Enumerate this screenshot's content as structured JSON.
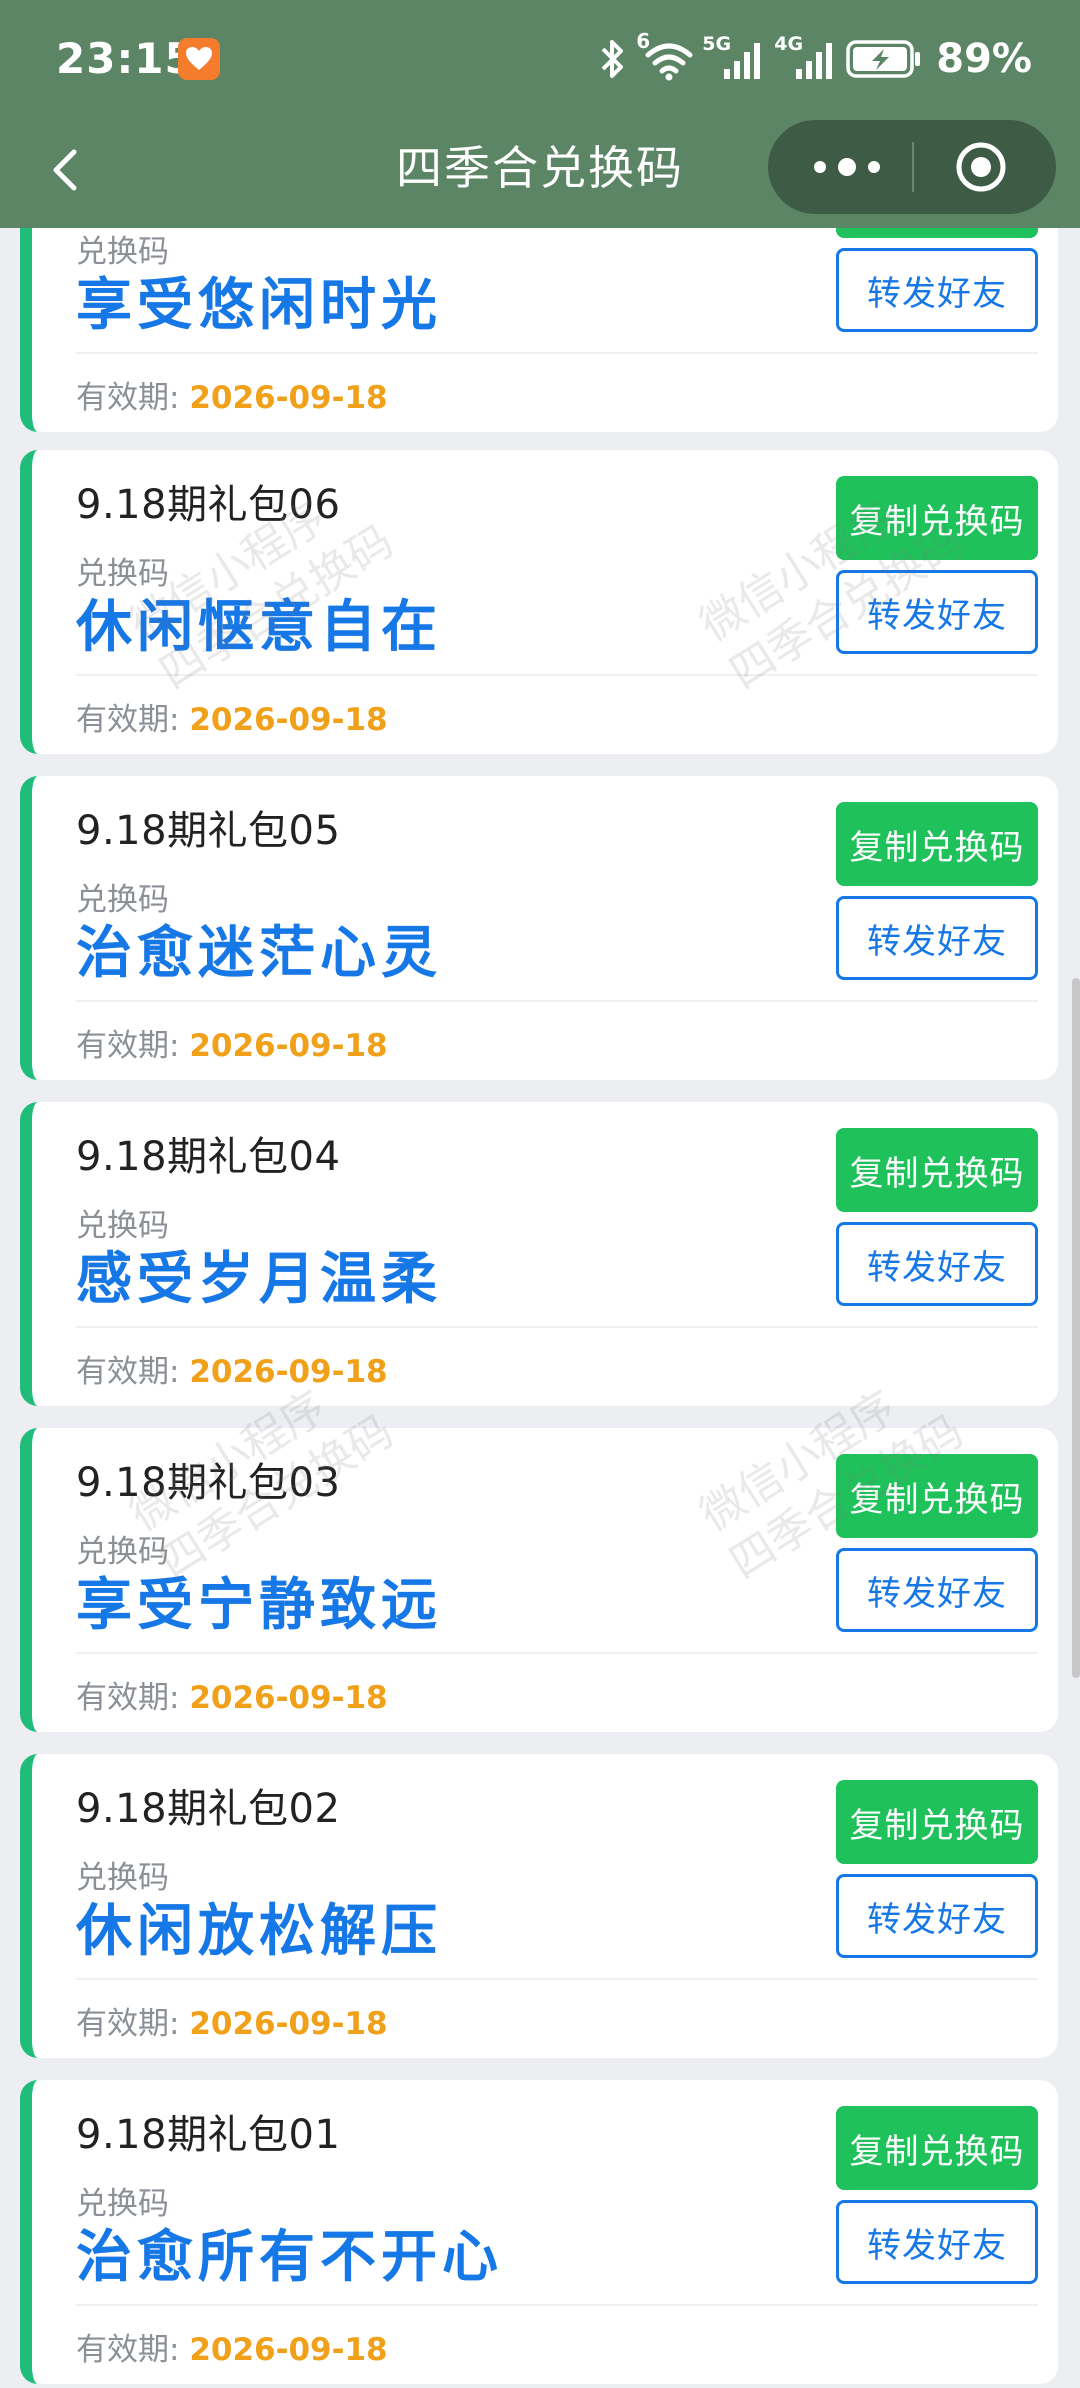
{
  "status": {
    "time": "23:15",
    "battery": "89%",
    "net_5g": "5G",
    "net_4g": "4G",
    "wifi_sup": "6"
  },
  "nav": {
    "title": "四季合兑换码"
  },
  "labels": {
    "code_label": "兑换码",
    "expiry_label": "有效期:",
    "copy_button": "复制兑换码",
    "share_button": "转发好友"
  },
  "watermark": {
    "line1": "微信小程序",
    "line2": "四季合兑换码"
  },
  "cards": [
    {
      "name": "",
      "code": "享受悠闲时光",
      "expiry": "2026-09-18"
    },
    {
      "name": "9.18期礼包06",
      "code": "休闲惬意自在",
      "expiry": "2026-09-18"
    },
    {
      "name": "9.18期礼包05",
      "code": "治愈迷茫心灵",
      "expiry": "2026-09-18"
    },
    {
      "name": "9.18期礼包04",
      "code": "感受岁月温柔",
      "expiry": "2026-09-18"
    },
    {
      "name": "9.18期礼包03",
      "code": "享受宁静致远",
      "expiry": "2026-09-18"
    },
    {
      "name": "9.18期礼包02",
      "code": "休闲放松解压",
      "expiry": "2026-09-18"
    },
    {
      "name": "9.18期礼包01",
      "code": "治愈所有不开心",
      "expiry": "2026-09-18"
    }
  ],
  "colors": {
    "header_bg": "#5b8565",
    "accent_green": "#1fc15b",
    "accent_blue": "#1677e6",
    "expiry_orange": "#f0a019",
    "card_stripe": "#1fbd79"
  },
  "icons": {
    "back": "chevron-left-icon",
    "more": "more-dots-icon",
    "close": "target-close-icon",
    "bluetooth": "bluetooth-icon",
    "wifi": "wifi-icon",
    "signal": "signal-icon",
    "battery": "battery-charging-icon"
  }
}
